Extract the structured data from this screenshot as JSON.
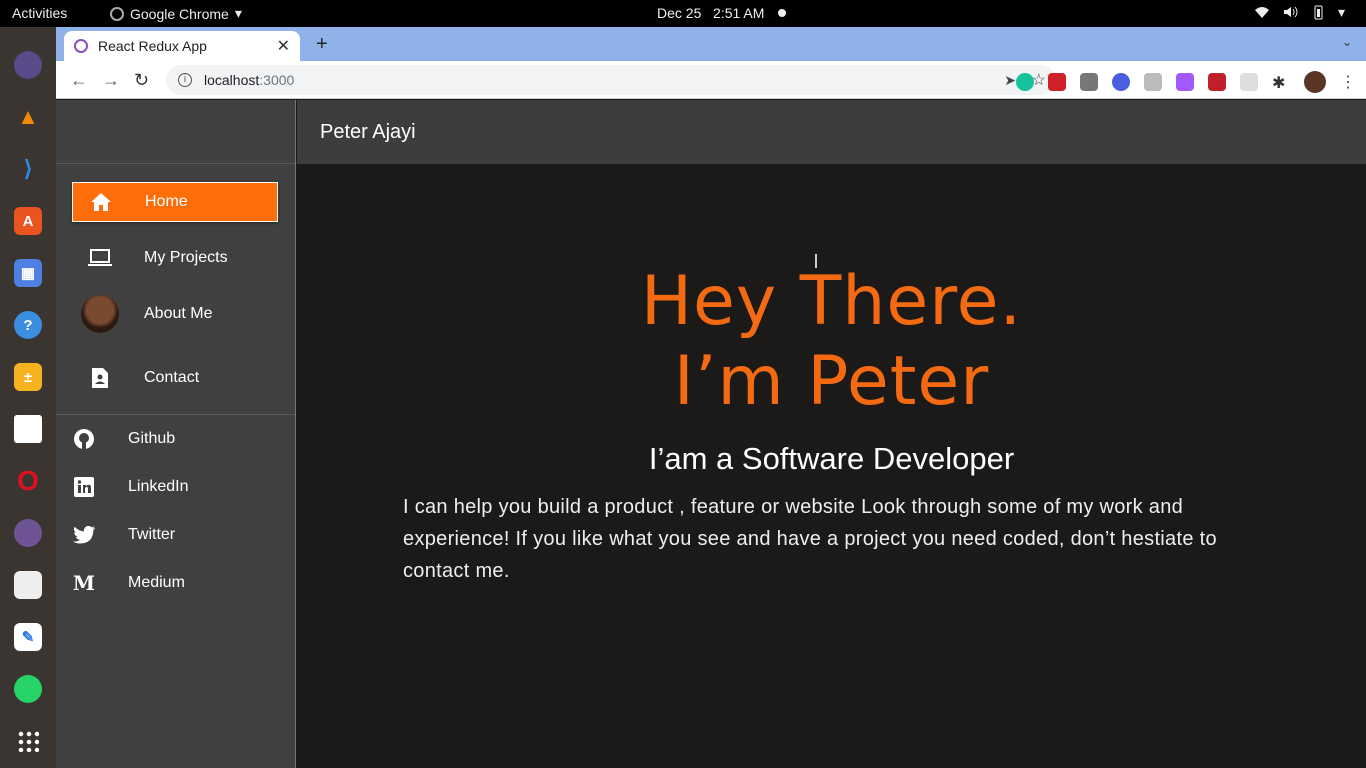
{
  "system": {
    "activities": "Activities",
    "app_name": "Google Chrome",
    "date": "Dec 25",
    "time": "2:51 AM"
  },
  "browser": {
    "tab_title": "React Redux App",
    "url_host": "localhost",
    "url_port": ":3000"
  },
  "app": {
    "header_title": "Peter Ajayi",
    "nav": [
      {
        "label": "Home",
        "icon": "home-icon",
        "active": true
      },
      {
        "label": "My Projects",
        "icon": "laptop-icon",
        "active": false
      },
      {
        "label": "About Me",
        "icon": "avatar",
        "active": false
      },
      {
        "label": "Contact",
        "icon": "contact-icon",
        "active": false
      }
    ],
    "social": [
      {
        "label": "Github",
        "icon": "github-icon"
      },
      {
        "label": "LinkedIn",
        "icon": "linkedin-icon"
      },
      {
        "label": "Twitter",
        "icon": "twitter-icon"
      },
      {
        "label": "Medium",
        "icon": "medium-icon"
      }
    ],
    "hero": {
      "line1": "Hey There.",
      "line2": "I’m Peter",
      "subtitle": "I’am a Software Developer",
      "blurb": "I can help you build a product , feature or website Look through some of my work and experience! If you like what you see and have a project you need coded, don’t hestiate to contact me."
    }
  },
  "colors": {
    "accent": "#fd6e0a",
    "headline": "#f36a12",
    "sidebar_bg": "#404040",
    "page_bg": "#1b1a19"
  }
}
